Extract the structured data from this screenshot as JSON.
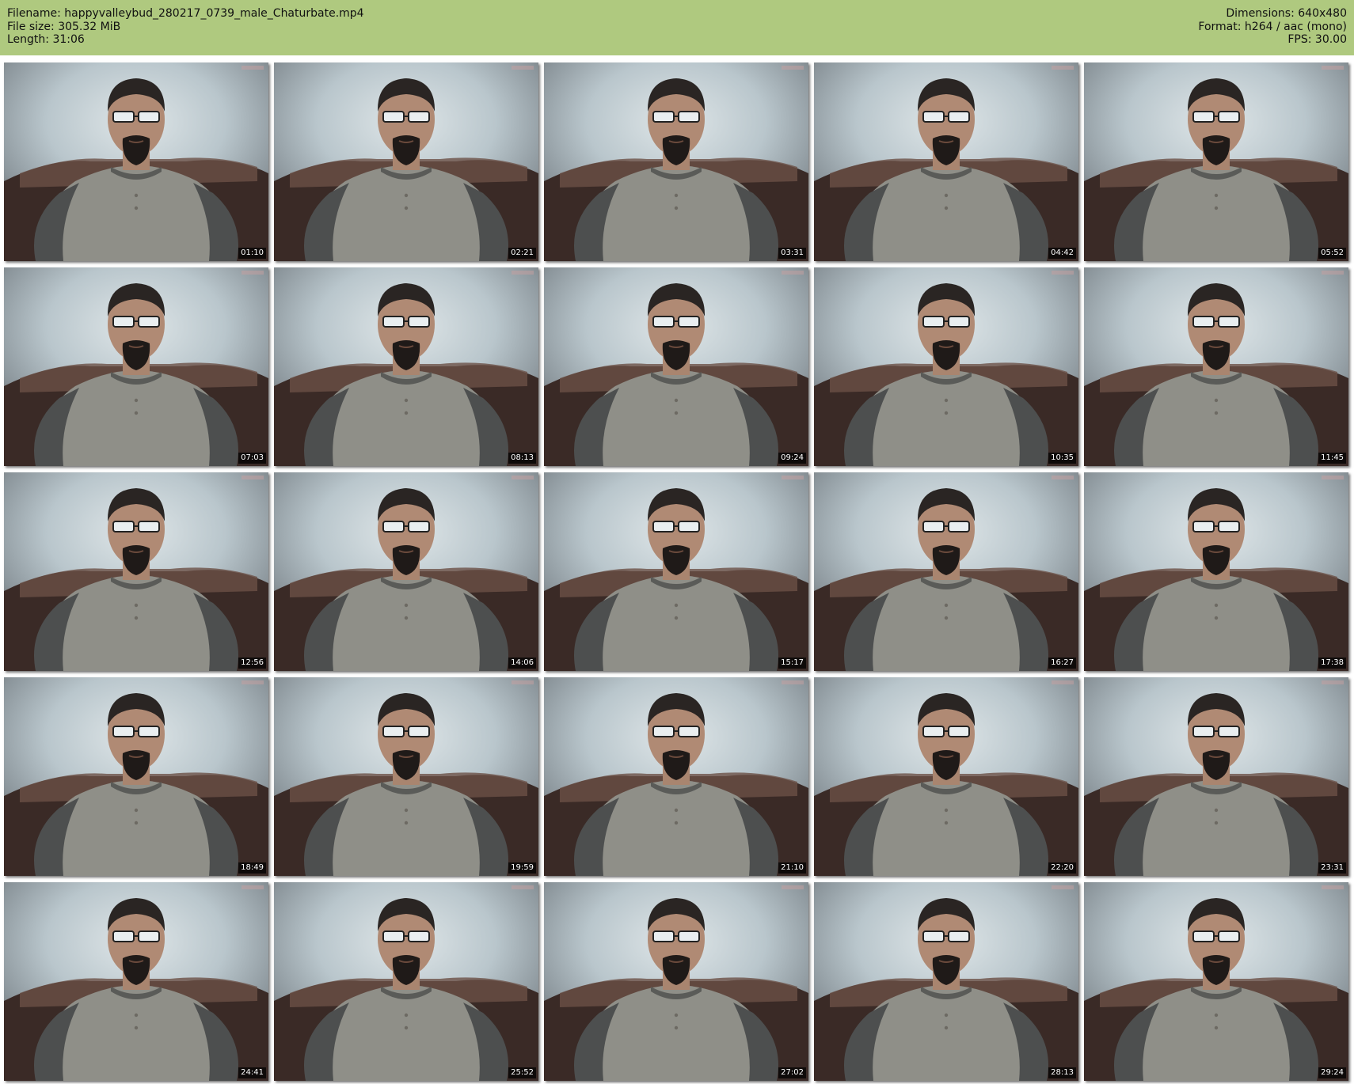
{
  "header": {
    "filename": "Filename: happyvalleybud_280217_0739_male_Chaturbate.mp4",
    "filesize": "File size: 305.32 MiB",
    "length": "Length: 31:06",
    "dimensions": "Dimensions: 640x480",
    "format": "Format: h264 / aac (mono)",
    "fps": "FPS: 30.00"
  },
  "colors": {
    "header_bg": "#afc97f",
    "page_bg": "#ffffff"
  },
  "thumbnails": [
    "01:10",
    "02:21",
    "03:31",
    "04:42",
    "05:52",
    "07:03",
    "08:13",
    "09:24",
    "10:35",
    "11:45",
    "12:56",
    "14:06",
    "15:17",
    "16:27",
    "17:38",
    "18:49",
    "19:59",
    "21:10",
    "22:20",
    "23:31",
    "24:41",
    "25:52",
    "27:02",
    "28:13",
    "29:24"
  ]
}
